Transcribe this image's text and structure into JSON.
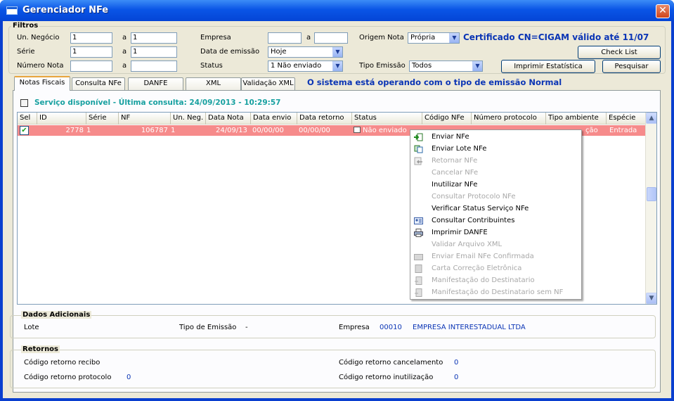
{
  "window": {
    "title": "Gerenciador NFe",
    "close_glyph": "✕"
  },
  "filters": {
    "legend": "Filtros",
    "un_negocio": {
      "label": "Un. Negócio",
      "from": "1",
      "to_label": "a",
      "to": "1"
    },
    "serie": {
      "label": "Série",
      "from": "1",
      "to_label": "a",
      "to": "1"
    },
    "numero_nota": {
      "label": "Número Nota",
      "from": "",
      "to_label": "a",
      "to": ""
    },
    "empresa": {
      "label": "Empresa",
      "from": "",
      "to_label": "a",
      "to": ""
    },
    "data_emissao": {
      "label": "Data de emissão",
      "value": "Hoje"
    },
    "status": {
      "label": "Status",
      "value": "1 Não enviado"
    },
    "origem_nota": {
      "label": "Origem Nota",
      "value": "Própria"
    },
    "tipo_emissao": {
      "label": "Tipo Emissão",
      "value": "Todos"
    },
    "certificado": "Certificado CN=CIGAM válido até 11/07",
    "buttons": {
      "check_list": "Check List",
      "imprimir": "Imprimir Estatística",
      "pesquisar": "Pesquisar"
    }
  },
  "tabs": [
    {
      "label": "Notas Fiscais",
      "active": true
    },
    {
      "label": "Consulta NFe"
    },
    {
      "label": "DANFE"
    },
    {
      "label": "XML"
    },
    {
      "label": "Validação XML"
    }
  ],
  "tab_message": "O sistema está operando com o tipo de emissão Normal",
  "service_status": "Serviço disponível - Última consulta: 24/09/2013 - 10:29:57",
  "grid": {
    "columns": [
      "Sel",
      "ID",
      "Série",
      "NF",
      "Un. Neg.",
      "Data Nota",
      "Data envio",
      "Data retorno",
      "Status",
      "Código NFe",
      "Número protocolo",
      "Tipo ambiente",
      "Espécie"
    ],
    "row": {
      "checked": "✔",
      "id": "2778",
      "serie": "1",
      "nf": "106787",
      "un_neg": "1",
      "data_nota": "24/09/13",
      "data_envio": "00/00/00",
      "data_retorno": "00/00/00",
      "status": "Não enviado",
      "tipo_ambiente_partial": "ção",
      "especie": "Entrada",
      "color": "#f68b8b"
    },
    "scroll_up": "▲",
    "scroll_down": "▼"
  },
  "context_menu": [
    {
      "label": "Enviar NFe",
      "enabled": true,
      "icon": "send-icon"
    },
    {
      "label": "Enviar Lote NFe",
      "enabled": true,
      "icon": "batch-send-icon"
    },
    {
      "label": "Retornar NFe",
      "enabled": false,
      "icon": "return-icon"
    },
    {
      "label": "Cancelar NFe",
      "enabled": false
    },
    {
      "label": "Inutilizar NFe",
      "enabled": true
    },
    {
      "label": "Consultar Protocolo NFe",
      "enabled": false
    },
    {
      "label": "Verificar Status Serviço NFe",
      "enabled": true
    },
    {
      "label": "Consultar Contribuintes",
      "enabled": true,
      "icon": "contact-card-icon"
    },
    {
      "label": "Imprimir DANFE",
      "enabled": true,
      "icon": "printer-icon"
    },
    {
      "label": "Validar Arquivo XML",
      "enabled": false
    },
    {
      "label": "Enviar Email NFe Confirmada",
      "enabled": false,
      "icon": "email-icon"
    },
    {
      "label": "Carta Correção Eletrônica",
      "enabled": false,
      "icon": "letter-icon"
    },
    {
      "label": "Manifestação do Destinatario",
      "enabled": false,
      "icon": "manifest-icon"
    },
    {
      "label": "Manifestação do Destinatario sem NF",
      "enabled": false,
      "icon": "manifest-icon"
    }
  ],
  "dados_adicionais": {
    "legend": "Dados Adicionais",
    "lote_label": "Lote",
    "tipo_emissao_label": "Tipo de Emissão",
    "tipo_emissao_value": "-",
    "empresa_label": "Empresa",
    "empresa_code": "00010",
    "empresa_name": "EMPRESA INTERESTADUAL LTDA"
  },
  "retornos": {
    "legend": "Retornos",
    "recibo_label": "Código retorno recibo",
    "protocolo_label": "Código retorno protocolo",
    "protocolo_value": "0",
    "cancelamento_label": "Código retorno cancelamento",
    "cancelamento_value": "0",
    "inutilizacao_label": "Código retorno inutilização",
    "inutilizacao_value": "0"
  },
  "colors": {
    "title_blue": "#0a55e6",
    "accent_blue": "#0b35b5",
    "service_teal": "#17a0a0",
    "row_red": "#f68b8b"
  }
}
